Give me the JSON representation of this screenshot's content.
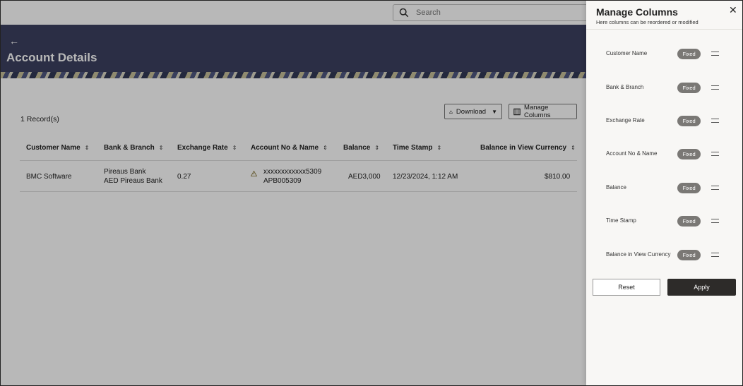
{
  "search": {
    "placeholder": "Search"
  },
  "header": {
    "back_glyph": "←",
    "title": "Account Details"
  },
  "records_label": "1 Record(s)",
  "toolbar": {
    "download_label": "Download",
    "manage_columns_label": "Manage Columns"
  },
  "table": {
    "headers": [
      "Customer Name",
      "Bank & Branch",
      "Exchange Rate",
      "Account No & Name",
      "Balance",
      "Time Stamp",
      "Balance in View Currency"
    ],
    "rows": [
      {
        "customer": "BMC Software",
        "bank": "Pireaus Bank",
        "branch": "AED Pireaus Bank",
        "rate": "0.27",
        "account_no": "xxxxxxxxxxxx5309",
        "account_name": "APB005309",
        "balance": "AED3,000",
        "timestamp": "12/23/2024, 1:12 AM",
        "view_balance": "$810.00"
      }
    ]
  },
  "panel": {
    "title": "Manage Columns",
    "subtitle": "Here columns can be reordered or modified",
    "columns": [
      {
        "label": "Customer Name",
        "badge": "Fixed"
      },
      {
        "label": "Bank & Branch",
        "badge": "Fixed"
      },
      {
        "label": "Exchange Rate",
        "badge": "Fixed"
      },
      {
        "label": "Account No & Name",
        "badge": "Fixed"
      },
      {
        "label": "Balance",
        "badge": "Fixed"
      },
      {
        "label": "Time Stamp",
        "badge": "Fixed"
      },
      {
        "label": "Balance in View Currency",
        "badge": "Fixed"
      }
    ],
    "reset_label": "Reset",
    "apply_label": "Apply"
  },
  "colors": {
    "header_bg": "#3c4160",
    "apply_bg": "#2d2b29",
    "badge_bg": "#7a7875",
    "panel_bg": "#f8f7f5"
  }
}
